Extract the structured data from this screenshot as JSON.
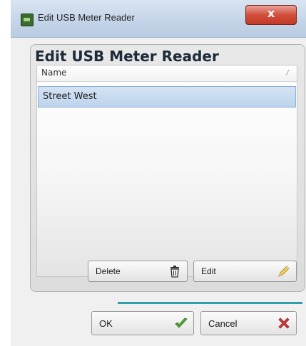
{
  "window": {
    "title": "Edit USB Meter Reader",
    "close_label": "x"
  },
  "panel": {
    "title": "Edit USB Meter Reader"
  },
  "list": {
    "column_header": "Name",
    "rows": [
      "Street West"
    ]
  },
  "actions": {
    "delete_label": "Delete",
    "edit_label": "Edit"
  },
  "footer": {
    "ok_label": "OK",
    "cancel_label": "Cancel"
  },
  "icons": {
    "app": "usb-meter-app-icon",
    "delete": "trash-icon",
    "edit": "edit-pencil-icon",
    "ok": "green-checkmark-icon",
    "cancel": "red-x-icon"
  },
  "colors": {
    "selection": "#c4d8ee",
    "close": "#c9412f",
    "accent_line": "#2f9fa8",
    "ok_check": "#5aa832",
    "cancel_x": "#d23a3a"
  }
}
